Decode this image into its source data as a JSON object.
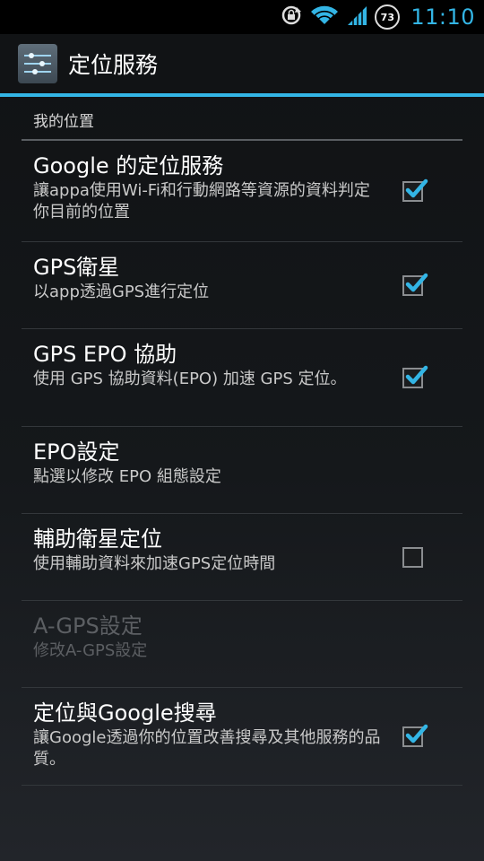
{
  "status_bar": {
    "time": "11:10",
    "battery_level": "73",
    "icons": [
      "sync-lock-icon",
      "wifi-icon",
      "signal-icon",
      "battery-icon"
    ]
  },
  "action_bar": {
    "title": "定位服務",
    "icon": "settings-sliders-icon"
  },
  "category": "我的位置",
  "accent_color": "#33b5e5",
  "items": [
    {
      "title": "Google 的定位服務",
      "summary": "讓appa使用Wi-Fi和行動網路等資源的資料判定你目前的位置",
      "checked": true,
      "enabled": true,
      "has_checkbox": true
    },
    {
      "title": "GPS衛星",
      "summary": "以app透過GPS進行定位",
      "checked": true,
      "enabled": true,
      "has_checkbox": true
    },
    {
      "title": "GPS EPO 協助",
      "summary": "使用 GPS 協助資料(EPO) 加速 GPS 定位。",
      "checked": true,
      "enabled": true,
      "has_checkbox": true
    },
    {
      "title": "EPO設定",
      "summary": "點選以修改 EPO 組態設定",
      "checked": false,
      "enabled": true,
      "has_checkbox": false
    },
    {
      "title": "輔助衛星定位",
      "summary": "使用輔助資料來加速GPS定位時間",
      "checked": false,
      "enabled": true,
      "has_checkbox": true
    },
    {
      "title": "A-GPS設定",
      "summary": "修改A-GPS設定",
      "checked": false,
      "enabled": false,
      "has_checkbox": false
    },
    {
      "title": "定位與Google搜尋",
      "summary": "讓Google透過你的位置改善搜尋及其他服務的品質。",
      "checked": true,
      "enabled": true,
      "has_checkbox": true
    }
  ]
}
